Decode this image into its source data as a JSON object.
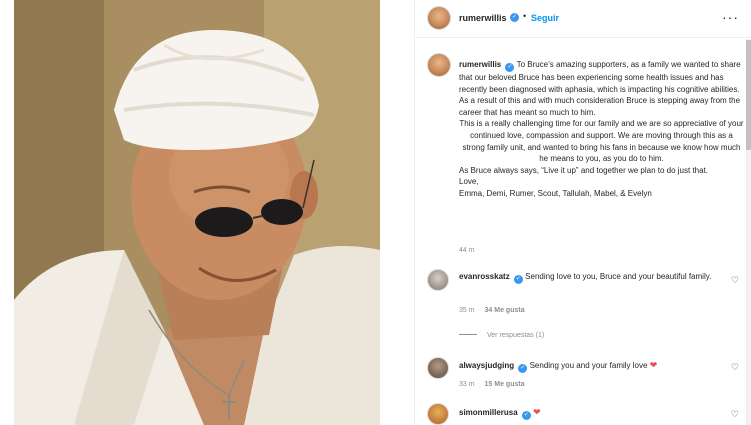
{
  "header": {
    "username": "rumerwillis",
    "follow_label": "Seguir",
    "more_icon": "ellipsis-icon"
  },
  "caption": {
    "username": "rumerwillis",
    "lines": [
      "To Bruce’s amazing supporters, as a family we wanted to share that our beloved Bruce has been experiencing some health issues and has recently been diagnosed with aphasia, which is impacting his cognitive abilities. As a result of this and with much consideration Bruce is stepping away from the career that has meant so much to him.",
      "This is a really challenging time for our family and we are so appreciative of your continued love, compassion and support. We are moving through this as a strong family unit, and wanted to bring his fans in because we know how much he means to you, as you do to him.",
      "As Bruce always says, “Live it up” and together we plan to do just that.",
      "Love,",
      "Emma, Demi, Rumer, Scout, Tallulah, Mabel, & Evelyn"
    ],
    "time": "44 m"
  },
  "comments": [
    {
      "username": "evanrosskatz",
      "text": "Sending love to you, Bruce and your beautiful family.",
      "time": "35 m",
      "likes": "34 Me gusta",
      "view_replies": "Ver respuestas (1)"
    },
    {
      "username": "alwaysjudging",
      "text": "Sending you and your family love",
      "emoji": "❤",
      "time": "33 m",
      "likes": "15 Me gusta"
    },
    {
      "username": "simonmillerusa",
      "emoji": "❤"
    }
  ],
  "colors": {
    "link_blue": "#0095f6",
    "verified_blue": "#3897f0",
    "heart_red": "#ed4956",
    "muted": "#8e8e8e"
  }
}
